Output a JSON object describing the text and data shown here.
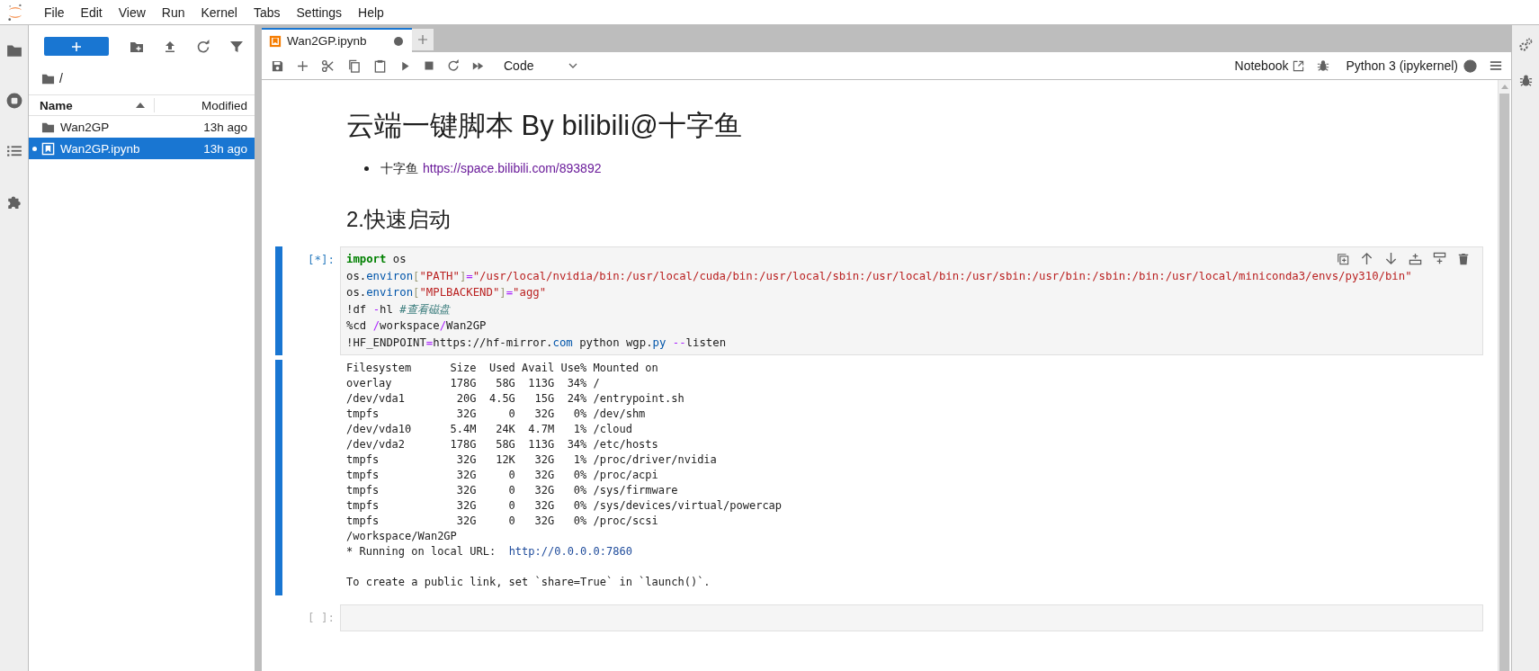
{
  "menu": [
    "File",
    "Edit",
    "View",
    "Run",
    "Kernel",
    "Tabs",
    "Settings",
    "Help"
  ],
  "file_browser": {
    "breadcrumb": "/",
    "columns": [
      {
        "label": "Name",
        "sort_ascending": true
      },
      {
        "label": "Modified"
      }
    ],
    "items": [
      {
        "kind": "folder",
        "name": "Wan2GP",
        "modified": "13h ago",
        "selected": false,
        "running": false
      },
      {
        "kind": "notebook",
        "name": "Wan2GP.ipynb",
        "modified": "13h ago",
        "selected": true,
        "running": true
      }
    ]
  },
  "tabs": [
    {
      "label": "Wan2GP.ipynb",
      "selected": true,
      "unsaved": true
    }
  ],
  "toolbar": {
    "cell_type": "Code",
    "notebook_link": "Notebook",
    "kernel": "Python 3 (ipykernel)",
    "kernel_busy": true
  },
  "cells": [
    {
      "kind": "heading1",
      "text": "云端一键脚本 By bilibili@十字鱼"
    },
    {
      "kind": "list",
      "items": [
        {
          "text": "十字鱼",
          "link": "https://space.bilibili.com/893892"
        }
      ]
    },
    {
      "kind": "heading2",
      "text": "2.快速启动"
    },
    {
      "kind": "code",
      "prompt": "[*]:",
      "active": true,
      "lines": [
        [
          {
            "t": "import",
            "kind": "keyword"
          },
          {
            "t": " os",
            "kind": "plain"
          }
        ],
        [
          {
            "t": "os.",
            "kind": "plain"
          },
          {
            "t": "environ",
            "kind": "attr"
          },
          {
            "t": "[",
            "kind": "bracket"
          },
          {
            "t": "\"PATH\"",
            "kind": "string"
          },
          {
            "t": "]",
            "kind": "bracket"
          },
          {
            "t": "=",
            "kind": "operator"
          },
          {
            "t": "\"/usr/local/nvidia/bin:/usr/local/cuda/bin:/usr/local/sbin:/usr/local/bin:/usr/sbin:/usr/bin:/sbin:/bin:/usr/local/miniconda3/envs/py310/bin\"",
            "kind": "string"
          }
        ],
        [
          {
            "t": "os.",
            "kind": "plain"
          },
          {
            "t": "environ",
            "kind": "attr"
          },
          {
            "t": "[",
            "kind": "bracket"
          },
          {
            "t": "\"MPLBACKEND\"",
            "kind": "string"
          },
          {
            "t": "]",
            "kind": "bracket"
          },
          {
            "t": "=",
            "kind": "operator"
          },
          {
            "t": "\"agg\"",
            "kind": "string"
          }
        ],
        [
          {
            "t": "!df ",
            "kind": "plain"
          },
          {
            "t": "-",
            "kind": "operator"
          },
          {
            "t": "hl ",
            "kind": "plain"
          },
          {
            "t": "#查看磁盘",
            "kind": "comment"
          }
        ],
        [
          {
            "t": "%cd ",
            "kind": "plain"
          },
          {
            "t": "/",
            "kind": "operator"
          },
          {
            "t": "workspace",
            "kind": "plain"
          },
          {
            "t": "/",
            "kind": "operator"
          },
          {
            "t": "Wan2GP",
            "kind": "plain"
          }
        ],
        [
          {
            "t": "!HF_ENDPOINT",
            "kind": "plain"
          },
          {
            "t": "=",
            "kind": "operator"
          },
          {
            "t": "https://hf-mirror.",
            "kind": "plain"
          },
          {
            "t": "com",
            "kind": "attr"
          },
          {
            "t": " python wgp.",
            "kind": "plain"
          },
          {
            "t": "py",
            "kind": "attr"
          },
          {
            "t": " --",
            "kind": "operator"
          },
          {
            "t": "listen",
            "kind": "plain"
          }
        ]
      ],
      "output": [
        {
          "lines": [
            {
              "text": "Filesystem      Size  Used Avail Use% Mounted on"
            },
            {
              "text": "overlay         178G   58G  113G  34% /"
            },
            {
              "text": "/dev/vda1        20G  4.5G   15G  24% /entrypoint.sh"
            },
            {
              "text": "tmpfs            32G     0   32G   0% /dev/shm"
            },
            {
              "text": "/dev/vda10      5.4M   24K  4.7M   1% /cloud"
            },
            {
              "text": "/dev/vda2       178G   58G  113G  34% /etc/hosts"
            },
            {
              "text": "tmpfs            32G   12K   32G   1% /proc/driver/nvidia"
            },
            {
              "text": "tmpfs            32G     0   32G   0% /proc/acpi"
            },
            {
              "text": "tmpfs            32G     0   32G   0% /sys/firmware"
            },
            {
              "text": "tmpfs            32G     0   32G   0% /sys/devices/virtual/powercap"
            },
            {
              "text": "tmpfs            32G     0   32G   0% /proc/scsi"
            },
            {
              "text": "/workspace/Wan2GP"
            },
            {
              "text": "* Running on local URL:  ",
              "link": "http://0.0.0.0:7860"
            }
          ]
        },
        {
          "lines": [
            {
              "text": "To create a public link, set `share=True` in `launch()`."
            }
          ]
        }
      ]
    },
    {
      "kind": "code",
      "prompt": "[ ]:",
      "active": false
    }
  ]
}
